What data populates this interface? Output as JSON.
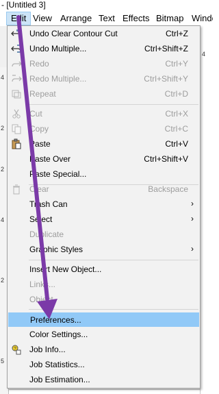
{
  "window": {
    "title": "- [Untitled 3]"
  },
  "menubar": {
    "items": [
      {
        "label": "Edit",
        "name": "menu-edit",
        "active": true
      },
      {
        "label": "View",
        "name": "menu-view"
      },
      {
        "label": "Arrange",
        "name": "menu-arrange"
      },
      {
        "label": "Text",
        "name": "menu-text"
      },
      {
        "label": "Effects",
        "name": "menu-effects"
      },
      {
        "label": "Bitmap",
        "name": "menu-bitmap"
      },
      {
        "label": "Windo",
        "name": "menu-window"
      }
    ]
  },
  "ruler": {
    "ticks": [
      "4",
      "2",
      "2",
      "4",
      "2",
      "5"
    ]
  },
  "canvas": {
    "corner_label": "4"
  },
  "edit_menu": {
    "items": [
      {
        "label": "Undo Clear Contour Cut",
        "shortcut": "Ctrl+Z",
        "icon": "undo-icon"
      },
      {
        "label": "Undo Multiple...",
        "shortcut": "Ctrl+Shift+Z",
        "icon": "undo-multiple-icon"
      },
      {
        "label": "Redo",
        "shortcut": "Ctrl+Y",
        "icon": "redo-icon",
        "disabled": true
      },
      {
        "label": "Redo Multiple...",
        "shortcut": "Ctrl+Shift+Y",
        "icon": "redo-multiple-icon",
        "disabled": true
      },
      {
        "label": "Repeat",
        "shortcut": "Ctrl+D",
        "icon": "repeat-icon",
        "disabled": true
      },
      {
        "label": "Cut",
        "shortcut": "Ctrl+X",
        "icon": "scissors-icon",
        "disabled": true
      },
      {
        "label": "Copy",
        "shortcut": "Ctrl+C",
        "icon": "copy-icon",
        "disabled": true
      },
      {
        "label": "Paste",
        "shortcut": "Ctrl+V",
        "icon": "paste-icon"
      },
      {
        "label": "Paste Over",
        "shortcut": "Ctrl+Shift+V"
      },
      {
        "label": "Paste Special..."
      },
      {
        "label": "Clear",
        "shortcut": "Backspace",
        "icon": "trash-icon",
        "disabled": true
      },
      {
        "label": "Trash Can",
        "submenu": true
      },
      {
        "label": "Select",
        "submenu": true
      },
      {
        "label": "Duplicate",
        "disabled": true
      },
      {
        "label": "Graphic Styles",
        "submenu": true
      },
      {
        "label": "Insert New Object..."
      },
      {
        "label": "Links...",
        "disabled": true
      },
      {
        "label": "Object",
        "disabled": true
      },
      {
        "label": "Preferences...",
        "highlighted": true
      },
      {
        "label": "Color Settings..."
      },
      {
        "label": "Job Info...",
        "icon": "job-info-icon"
      },
      {
        "label": "Job Statistics..."
      },
      {
        "label": "Job Estimation..."
      }
    ]
  },
  "colors": {
    "menu_bg": "#f2f2f2",
    "highlight": "#91c9f7",
    "disabled_text": "#9d9d9d",
    "annotation_arrow": "#7b3aa8"
  }
}
